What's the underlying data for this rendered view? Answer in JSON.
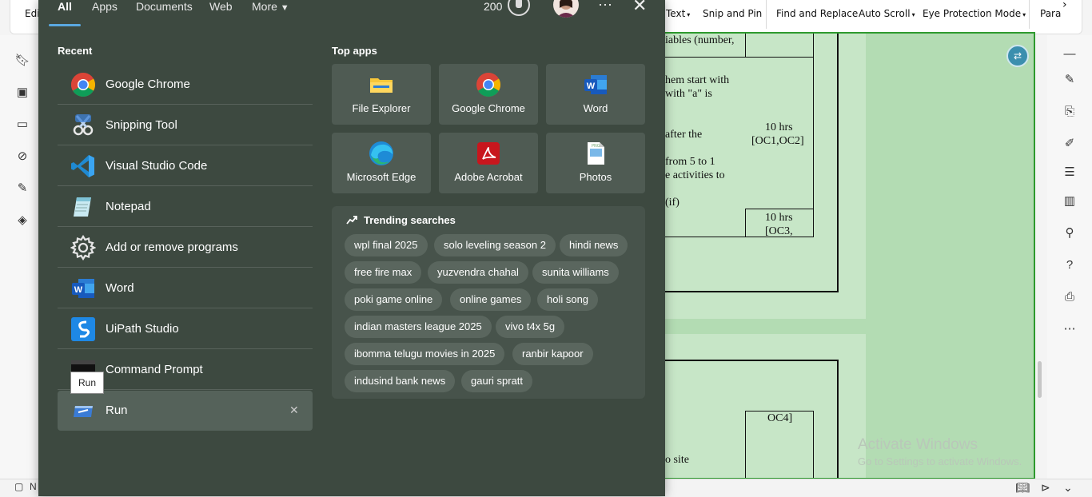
{
  "start": {
    "tabs": [
      "All",
      "Apps",
      "Documents",
      "Web",
      "More"
    ],
    "points": "200",
    "recent_title": "Recent",
    "recent": [
      {
        "label": "Google Chrome",
        "icon": "chrome-icon"
      },
      {
        "label": "Snipping Tool",
        "icon": "snipping-tool-icon"
      },
      {
        "label": "Visual Studio Code",
        "icon": "vscode-icon"
      },
      {
        "label": "Notepad",
        "icon": "notepad-icon"
      },
      {
        "label": "Add or remove programs",
        "icon": "gear-icon"
      },
      {
        "label": "Word",
        "icon": "word-icon"
      },
      {
        "label": "UiPath Studio",
        "icon": "uipath-icon"
      },
      {
        "label": "Command Prompt",
        "icon": "command-prompt-icon"
      },
      {
        "label": "Run",
        "icon": "run-icon"
      }
    ],
    "tooltip": "Run",
    "top_apps_title": "Top apps",
    "top_apps": [
      {
        "label": "File Explorer",
        "icon": "file-explorer-icon"
      },
      {
        "label": "Google Chrome",
        "icon": "chrome-icon"
      },
      {
        "label": "Word",
        "icon": "word-icon"
      },
      {
        "label": "Microsoft Edge",
        "icon": "edge-icon"
      },
      {
        "label": "Adobe Acrobat",
        "icon": "acrobat-icon"
      },
      {
        "label": "Photos",
        "icon": "photos-icon"
      }
    ],
    "trending_title": "Trending searches",
    "trending": [
      [
        "wpl final 2025",
        "solo leveling season 2",
        "hindi news"
      ],
      [
        "free fire max",
        "yuzvendra chahal",
        "sunita williams"
      ],
      [
        "poki game online",
        "online games",
        "holi song"
      ],
      [
        "indian masters league 2025",
        "vivo t4x 5g"
      ],
      [
        "ibomma telugu movies in 2025",
        "ranbir kapoor"
      ],
      [
        "indusind bank news",
        "gauri spratt"
      ]
    ]
  },
  "app": {
    "toolbar": {
      "edit": "Edi",
      "text": "Text",
      "snip": "Snip and Pin",
      "find": "Find and Replace",
      "autoscroll": "Auto Scroll",
      "eye": "Eye Protection Mode",
      "para": "Para"
    },
    "status_left": "N",
    "doc": {
      "t1": "iables (number,",
      "t2": "hem start with",
      "t3": "with \"a\" is",
      "t4": "after the",
      "t5": "from 5 to 1",
      "t6": "e activities to",
      "t7": "(if)",
      "t8a": "10 hrs",
      "t8b": "[OC1,OC2]",
      "t9a": "10 hrs",
      "t9b": "[OC3,",
      "t10": "OC4]",
      "t11": "o site"
    },
    "watermark_title": "Activate Windows",
    "watermark_sub": "Go to Settings to activate Windows."
  }
}
